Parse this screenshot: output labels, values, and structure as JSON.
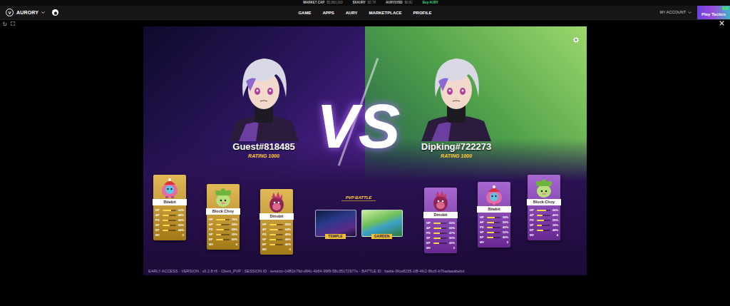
{
  "ticker": {
    "items": [
      {
        "label": "MARKET CAP",
        "value": "$5,860,000"
      },
      {
        "label": "$XAURY",
        "value": "$0.78"
      },
      {
        "label": "AURY/USD",
        "value": "$0.82"
      }
    ],
    "link": "Buy AURY"
  },
  "nav": {
    "logo": "V",
    "brand": "AURORY",
    "links": [
      {
        "label": "GAME"
      },
      {
        "label": "APPS"
      },
      {
        "label": "AURY"
      },
      {
        "label": "MARKETPLACE"
      },
      {
        "label": "PROFILE"
      }
    ],
    "account": "MY ACCOUNT",
    "play_button": "Play Tactics",
    "fps": "60"
  },
  "battle": {
    "vs": "VS",
    "mode": "PVP BATTLE",
    "players": [
      {
        "name": "Guest#818485",
        "rating": "RATING 1000",
        "color": "#d9a21f",
        "team": [
          {
            "name": "Bitebit",
            "kind": "bitebit",
            "stats": [
              {
                "label": "HP",
                "value": "62%",
                "level": 0.62,
                "kind": "bar"
              },
              {
                "label": "AP",
                "value": "48%",
                "level": 0.48,
                "kind": "bar"
              },
              {
                "label": "PD",
                "value": "40%",
                "level": 0.4,
                "kind": "bar"
              },
              {
                "label": "SP",
                "value": "55%",
                "level": 0.55,
                "kind": "bar"
              },
              {
                "label": "EP",
                "value": "44%",
                "level": 0.44,
                "kind": "bar"
              },
              {
                "label": "MV",
                "value": "5",
                "kind": "plain"
              }
            ]
          },
          {
            "name": "Block Choy",
            "kind": "blockchoy",
            "stats": [
              {
                "label": "HP",
                "value": "70%",
                "level": 0.7,
                "kind": "bar"
              },
              {
                "label": "AP",
                "value": "38%",
                "level": 0.38,
                "kind": "bar"
              },
              {
                "label": "PD",
                "value": "58%",
                "level": 0.58,
                "kind": "bar"
              },
              {
                "label": "SP",
                "value": "35%",
                "level": 0.35,
                "kind": "bar"
              },
              {
                "label": "EP",
                "value": "50%",
                "level": 0.5,
                "kind": "bar"
              },
              {
                "label": "MV",
                "value": "4",
                "kind": "plain"
              }
            ]
          },
          {
            "name": "Dinobit",
            "kind": "dinobit",
            "stats": [
              {
                "label": "HP",
                "value": "55%",
                "level": 0.55,
                "kind": "bar"
              },
              {
                "label": "AP",
                "value": "64%",
                "level": 0.64,
                "kind": "bar"
              },
              {
                "label": "PD",
                "value": "45%",
                "level": 0.45,
                "kind": "bar"
              },
              {
                "label": "SP",
                "value": "48%",
                "level": 0.48,
                "kind": "bar"
              },
              {
                "label": "EP",
                "value": "40%",
                "level": 0.4,
                "kind": "bar"
              },
              {
                "label": "MV",
                "value": "5",
                "kind": "plain"
              }
            ]
          }
        ]
      },
      {
        "name": "Dipking#722273",
        "rating": "RATING 1000",
        "color": "#8a35c2",
        "team": [
          {
            "name": "Dinobit",
            "kind": "dinobit",
            "stats": [
              {
                "label": "HP",
                "value": "52%",
                "level": 0.52,
                "kind": "bar"
              },
              {
                "label": "AP",
                "value": "60%",
                "level": 0.6,
                "kind": "bar"
              },
              {
                "label": "PD",
                "value": "47%",
                "level": 0.47,
                "kind": "bar"
              },
              {
                "label": "SP",
                "value": "50%",
                "level": 0.5,
                "kind": "bar"
              },
              {
                "label": "EP",
                "value": "42%",
                "level": 0.42,
                "kind": "bar"
              },
              {
                "label": "MV",
                "value": "5",
                "kind": "plain"
              }
            ]
          },
          {
            "name": "Bitebit",
            "kind": "bitebit",
            "stats": [
              {
                "label": "HP",
                "value": "58%",
                "level": 0.58,
                "kind": "bar"
              },
              {
                "label": "AP",
                "value": "50%",
                "level": 0.5,
                "kind": "bar"
              },
              {
                "label": "PD",
                "value": "42%",
                "level": 0.42,
                "kind": "bar"
              },
              {
                "label": "SP",
                "value": "52%",
                "level": 0.52,
                "kind": "bar"
              },
              {
                "label": "EP",
                "value": "46%",
                "level": 0.46,
                "kind": "bar"
              },
              {
                "label": "MV",
                "value": "5",
                "kind": "plain"
              }
            ]
          },
          {
            "name": "Block Choy",
            "kind": "blockchoy",
            "stats": [
              {
                "label": "HP",
                "value": "66%",
                "level": 0.66,
                "kind": "bar"
              },
              {
                "label": "AP",
                "value": "40%",
                "level": 0.4,
                "kind": "bar"
              },
              {
                "label": "PD",
                "value": "55%",
                "level": 0.55,
                "kind": "bar"
              },
              {
                "label": "SP",
                "value": "38%",
                "level": 0.38,
                "kind": "bar"
              },
              {
                "label": "EP",
                "value": "48%",
                "level": 0.48,
                "kind": "bar"
              },
              {
                "label": "MV",
                "value": "4",
                "kind": "plain"
              }
            ]
          }
        ]
      }
    ],
    "maps": [
      {
        "label": "TEMPLE"
      },
      {
        "label": "GARDEN"
      }
    ],
    "footer": "EARLY ACCESS - VERSION : v0.2.8 r6 - Client_PVP - SESSION ID : session-0481b79d-d94c-4b64-99f9-58c35172977e - BATTLE ID : battle-9fce8235-1f8-4fc2-8bc6-b7badaaabebd"
  }
}
